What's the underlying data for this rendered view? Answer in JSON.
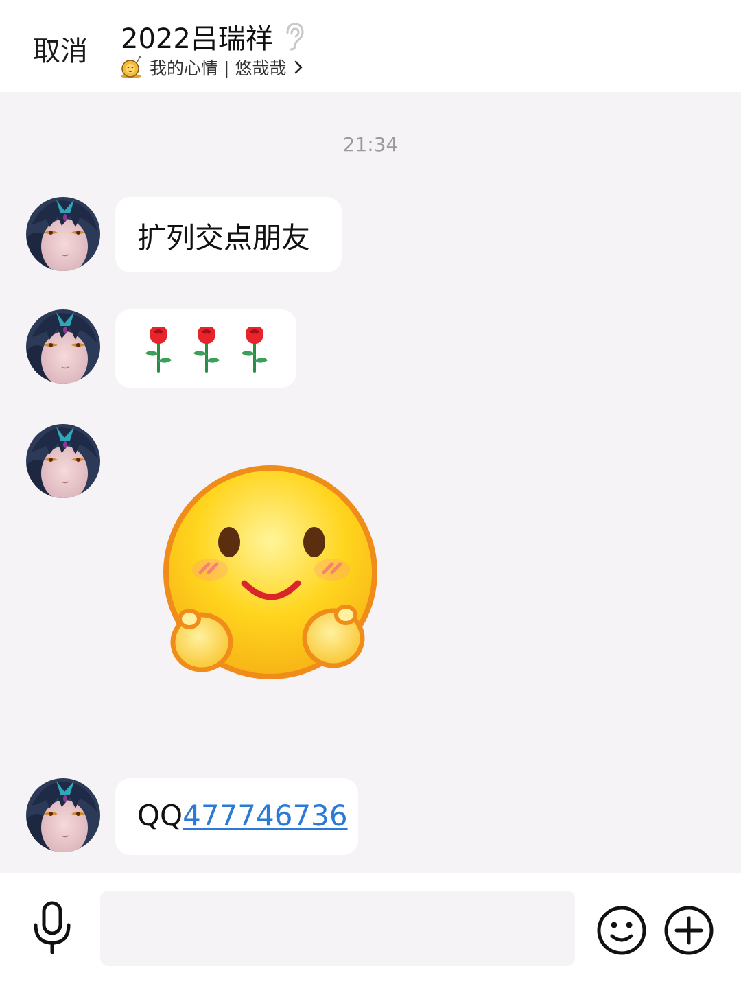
{
  "header": {
    "cancel_label": "取消",
    "title": "2022吕瑞祥",
    "subtitle": "我的心情 | 悠哉哉",
    "ear_icon": "ear-icon",
    "mood_icon": "snail-mood-icon"
  },
  "chat": {
    "timestamp": "21:34",
    "messages": [
      {
        "type": "text",
        "text": "扩列交点朋友"
      },
      {
        "type": "emoji",
        "icons": [
          "rose-icon",
          "rose-icon",
          "rose-icon"
        ]
      },
      {
        "type": "sticker",
        "icon": "smiling-hug-emoji"
      },
      {
        "type": "text",
        "prefix": "QQ",
        "link": "477746736"
      }
    ]
  },
  "input_bar": {
    "placeholder": "",
    "icons": [
      "microphone-icon",
      "smiley-icon",
      "plus-icon"
    ]
  },
  "colors": {
    "link": "#2a7ad6",
    "chat_bg": "#f5f3f6",
    "bubble_bg": "#ffffff"
  }
}
